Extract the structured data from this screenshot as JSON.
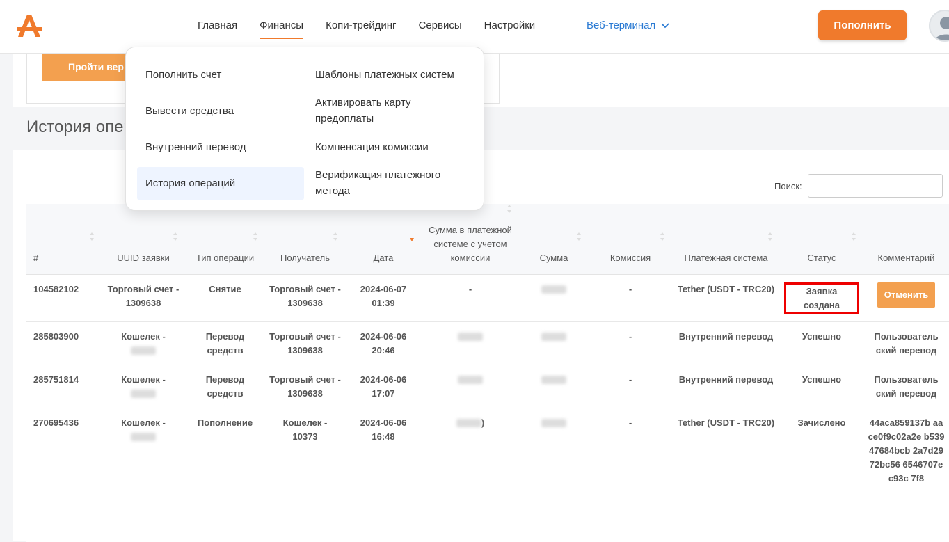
{
  "header": {
    "nav": [
      "Главная",
      "Финансы",
      "Копи-трейдинг",
      "Сервисы",
      "Настройки"
    ],
    "web_terminal": "Веб-терминал",
    "topup_label": "Пополнить"
  },
  "verify": {
    "button_label": "Пройти вер"
  },
  "section_title": "История опер",
  "search_label": "Поиск:",
  "dropdown": {
    "left": [
      "Пополнить счет",
      "Вывести средства",
      "Внутренний перевод",
      "История операций"
    ],
    "right": [
      "Шаблоны платежных систем",
      "Активировать карту предоплаты",
      "Компенсация комиссии",
      "Верификация платежного метода"
    ]
  },
  "table": {
    "columns": [
      "#",
      "UUID заявки",
      "Тип операции",
      "Получатель",
      "Дата",
      "Сумма в платежной системе с учетом комиссии",
      "Сумма",
      "Комиссия",
      "Платежная система",
      "Статус",
      "Комментарий"
    ],
    "rows": [
      {
        "id": "104582102",
        "uuid": "Торговый счет - 1309638",
        "type": "Снятие",
        "recipient": "Торговый счет - 1309638",
        "date": "2024-06-07 01:39",
        "sum_ps": "-",
        "sum": "",
        "fee": "-",
        "ps": "Tether (USDT - TRC20)",
        "status": "Заявка создана",
        "comment": "Отменить"
      },
      {
        "id": "285803900",
        "uuid": "Кошелек -",
        "type": "Перевод средств",
        "recipient": "Торговый счет - 1309638",
        "date": "2024-06-06 20:46",
        "sum_ps": "",
        "sum": "",
        "fee": "-",
        "ps": "Внутренний перевод",
        "status": "Успешно",
        "comment": "Пользователь ский перевод"
      },
      {
        "id": "285751814",
        "uuid": "Кошелек -",
        "type": "Перевод средств",
        "recipient": "Торговый счет - 1309638",
        "date": "2024-06-06 17:07",
        "sum_ps": "",
        "sum": "",
        "fee": "-",
        "ps": "Внутренний перевод",
        "status": "Успешно",
        "comment": "Пользователь ский перевод"
      },
      {
        "id": "270695436",
        "uuid": "Кошелек -",
        "type": "Пополнение",
        "recipient": "Кошелек - 10373",
        "date": "2024-06-06 16:48",
        "sum_ps": ")",
        "sum": "",
        "fee": "-",
        "ps": "Tether (USDT - TRC20)",
        "status": "Зачислено",
        "comment": "44aca859137b aace0f9c02a2e b53947684bcb 2a7d2972bc56 6546707ec93c 7f8"
      }
    ]
  },
  "colors": {
    "accent": "#f07a2c",
    "link": "#2a7ad3",
    "highlight": "#ff0000"
  }
}
